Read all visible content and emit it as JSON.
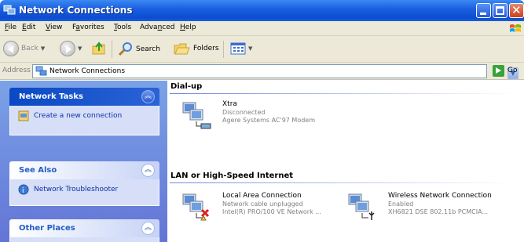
{
  "window": {
    "title": "Network Connections",
    "title_icon": "network-connections-icon"
  },
  "menu": [
    {
      "key": "F",
      "rest": "ile"
    },
    {
      "key": "E",
      "rest": "dit"
    },
    {
      "key": "V",
      "rest": "iew",
      "lead": ""
    },
    {
      "pre": "F",
      "key": "a",
      "rest": "vorites"
    },
    {
      "key": "T",
      "rest": "ools"
    },
    {
      "pre": "Adva",
      "key": "n",
      "rest": "ced"
    },
    {
      "key": "H",
      "rest": "elp"
    }
  ],
  "toolbar": {
    "back_label": "Back",
    "search_label": "Search",
    "folders_label": "Folders"
  },
  "address": {
    "label": "Address",
    "value": "Network Connections",
    "go_label": "Go"
  },
  "taskpane": {
    "network_tasks": {
      "title": "Network Tasks",
      "links": [
        "Create a new connection"
      ]
    },
    "see_also": {
      "title": "See Also",
      "links": [
        "Network Troubleshooter"
      ]
    },
    "other_places": {
      "title": "Other Places"
    }
  },
  "groups": {
    "dialup": {
      "title": "Dial-up",
      "items": [
        {
          "name": "Xtra",
          "status": "Disconnected",
          "device": "Agere Systems AC'97 Modem"
        }
      ]
    },
    "lan": {
      "title": "LAN or High-Speed Internet",
      "items": [
        {
          "name": "Local Area Connection",
          "status": "Network cable unplugged",
          "device": "Intel(R) PRO/100 VE Network ..."
        },
        {
          "name": "Wireless Network Connection",
          "status": "Enabled",
          "device": "XH6821 DSE 802.11b PCMCIA..."
        }
      ]
    }
  },
  "colors": {
    "titlebar": "#0a4dd3",
    "taskpane": "#6f8ee0",
    "link": "#0c32a8",
    "status_grey": "#808080"
  }
}
